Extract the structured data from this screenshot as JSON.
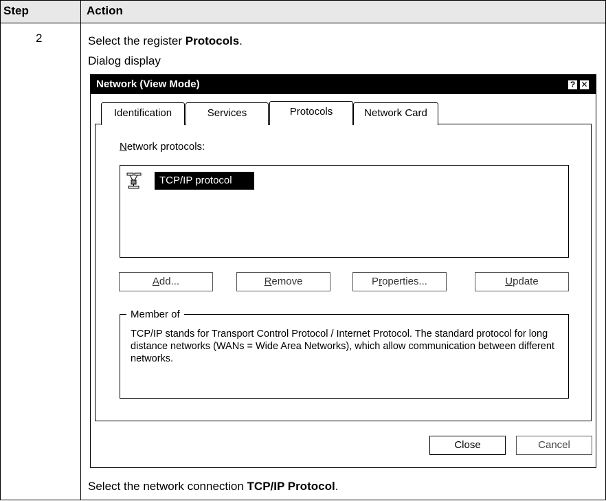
{
  "table": {
    "header_step": "Step",
    "header_action": "Action",
    "step_number": "2",
    "line1_prefix": "Select the register ",
    "line1_bold": "Protocols",
    "line1_suffix": ".",
    "line2": "Dialog display",
    "footer_prefix": "Select the network connection ",
    "footer_bold": "TCP/IP Protocol",
    "footer_suffix": "."
  },
  "dialog": {
    "title": "Network (View Mode)",
    "help_glyph": "?",
    "close_glyph": "✕",
    "tabs": [
      "Identification",
      "Services",
      "Protocols",
      "Network Card"
    ],
    "active_tab": "Protocols",
    "protocols_label_accel": "N",
    "protocols_label_rest": "etwork protocols:",
    "selected_protocol": "TCP/IP protocol",
    "protocol_icon": "network-protocol-icon",
    "buttons": {
      "add": {
        "accel": "A",
        "rest": "dd..."
      },
      "remove": {
        "accel": "R",
        "rest": "emove"
      },
      "properties": {
        "pre": "P",
        "accel": "r",
        "rest": "operties..."
      },
      "update": {
        "accel": "U",
        "rest": "pdate"
      }
    },
    "member_of_label": "Member of",
    "description": "TCP/IP stands for Transport Control Protocol / Internet Protocol. The standard protocol for long distance networks (WANs = Wide Area Networks), which allow communication between different networks.",
    "close_label": "Close",
    "cancel_label": "Cancel"
  }
}
